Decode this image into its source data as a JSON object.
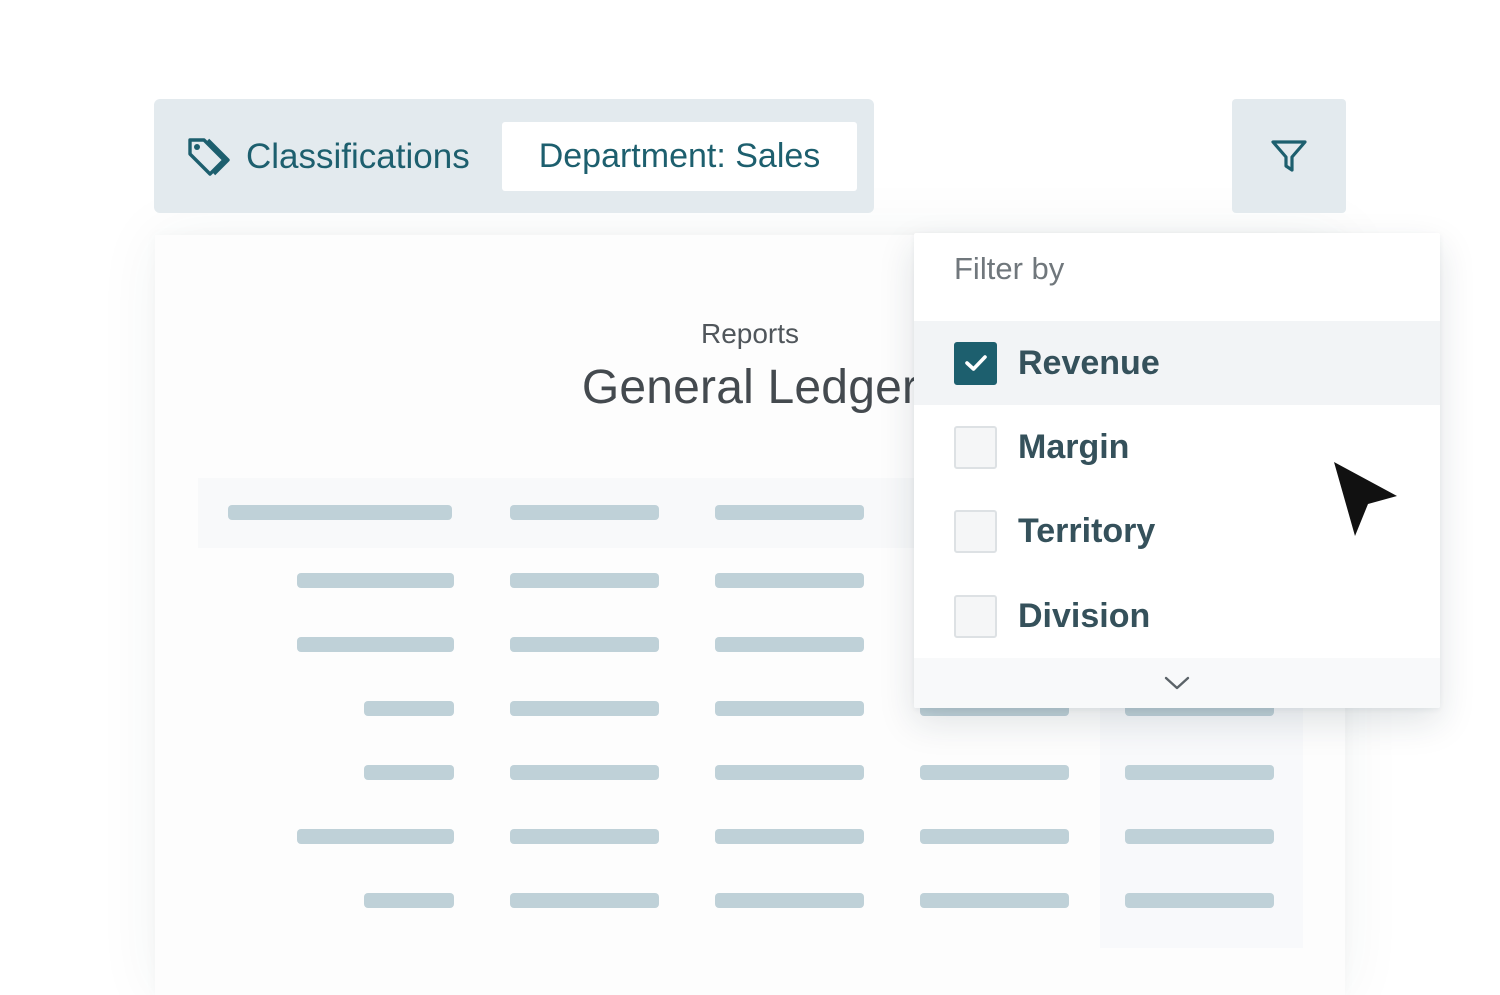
{
  "toolbar": {
    "icon": "tag-icon",
    "classifications_label": "Classifications",
    "department_chip": "Department: Sales",
    "filter_icon": "funnel-icon"
  },
  "report": {
    "kicker": "Reports",
    "title": "General Ledger"
  },
  "filter_menu": {
    "heading": "Filter by",
    "options": [
      {
        "label": "Revenue",
        "checked": true
      },
      {
        "label": "Margin",
        "checked": false
      },
      {
        "label": "Territory",
        "checked": false
      },
      {
        "label": "Division",
        "checked": false
      }
    ],
    "more_icon": "chevron-down-icon"
  },
  "colors": {
    "accent": "#1d5f6e",
    "chip_bg": "#e3eaee",
    "placeholder": "#bfd1d8"
  }
}
